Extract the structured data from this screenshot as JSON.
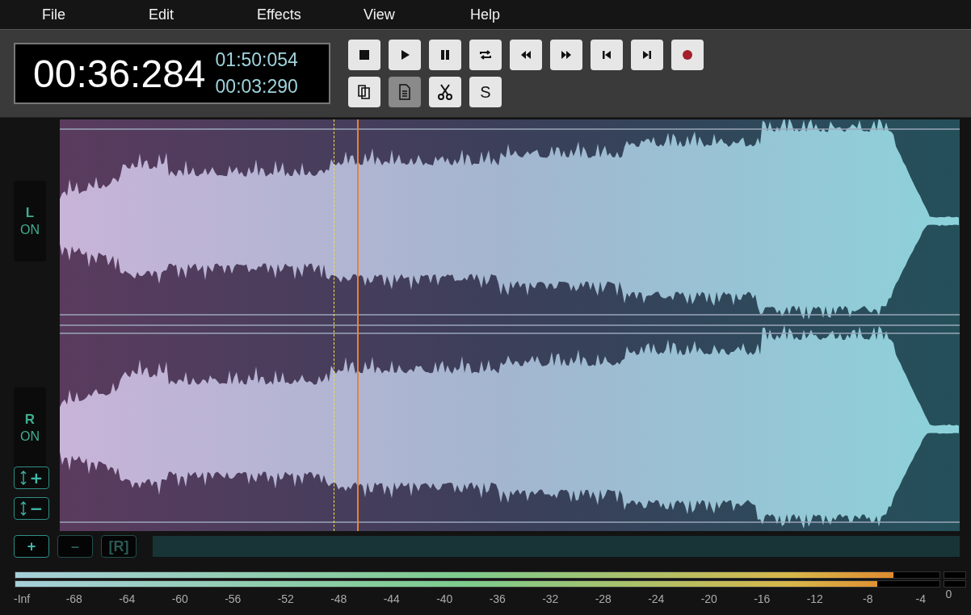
{
  "menu": [
    "File",
    "Edit",
    "Effects",
    "View",
    "Help"
  ],
  "time": {
    "current": "00:36:284",
    "total": "01:50:054",
    "selection": "00:03:290"
  },
  "transport": [
    {
      "kind": "stop",
      "pressed": false
    },
    {
      "kind": "play",
      "pressed": false
    },
    {
      "kind": "pause",
      "pressed": false
    },
    {
      "kind": "loop",
      "pressed": false
    },
    {
      "kind": "rewind",
      "pressed": false
    },
    {
      "kind": "forward",
      "pressed": false
    },
    {
      "kind": "to-start",
      "pressed": false
    },
    {
      "kind": "to-end",
      "pressed": false
    },
    {
      "kind": "record",
      "pressed": false
    }
  ],
  "edit_tools": [
    {
      "kind": "copy",
      "pressed": false
    },
    {
      "kind": "paste",
      "pressed": true
    },
    {
      "kind": "cut",
      "pressed": false
    },
    {
      "kind": "text",
      "label": "S",
      "pressed": false
    }
  ],
  "channels": [
    {
      "letter": "L",
      "state": "ON",
      "on": true
    },
    {
      "letter": "R",
      "state": "ON",
      "on": true
    }
  ],
  "zoom_buttons": [
    "+",
    "−"
  ],
  "bottom_buttons": [
    {
      "label": "+",
      "disabled": false
    },
    {
      "label": "–",
      "disabled": true
    },
    {
      "label": "[R]",
      "disabled": true
    }
  ],
  "meters": [
    {
      "level": 0.95
    },
    {
      "level": 0.933
    }
  ],
  "meter_scale": [
    "-Inf",
    "-68",
    "-64",
    "-60",
    "-56",
    "-52",
    "-48",
    "-44",
    "-40",
    "-36",
    "-32",
    "-28",
    "-24",
    "-20",
    "-16",
    "-12",
    "-8",
    "-4",
    "0"
  ]
}
